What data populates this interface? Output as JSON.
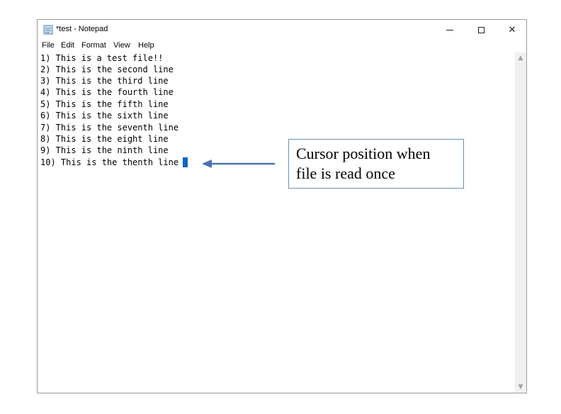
{
  "window": {
    "title": "*test - Notepad",
    "controls": {
      "minimize": "",
      "maximize": "",
      "close": "✕"
    }
  },
  "menu": [
    "File",
    "Edit",
    "Format",
    "View",
    "Help"
  ],
  "editor": {
    "lines": [
      "1) This is a test file!!",
      "2) This is the second line",
      "3) This is the third line",
      "4) This is the fourth line",
      "5) This is the fifth line",
      "6) This is the sixth line",
      "7) This is the seventh line",
      "8) This is the eight line",
      "9) This is the ninth line",
      "10) This is the thenth line"
    ]
  },
  "annotation": {
    "line1": "Cursor position when",
    "line2": "file is read once",
    "border_color": "#6b8fb5",
    "arrow_color": "#4a74b0"
  },
  "colors": {
    "caret": "#0a64c8"
  }
}
